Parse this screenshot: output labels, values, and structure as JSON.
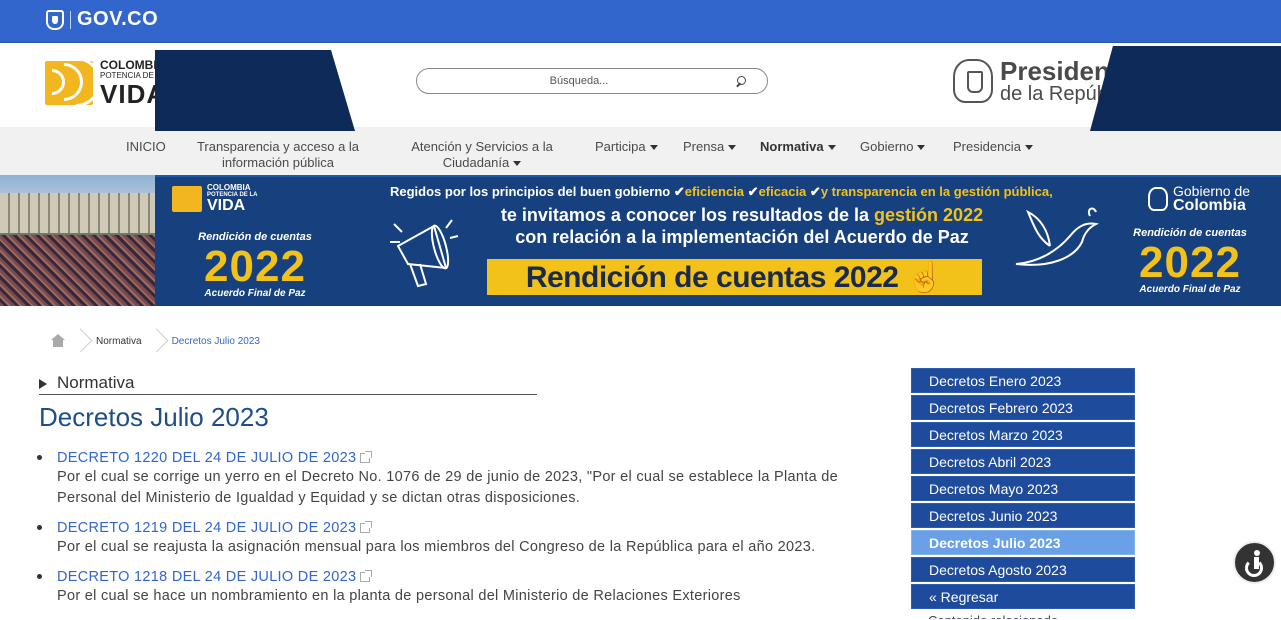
{
  "govco": {
    "logo_text": "GOV.CO"
  },
  "header": {
    "brand": {
      "line1": "COLOMBIA",
      "line2": "POTENCIA DE LA",
      "line3": "VIDA"
    },
    "search_placeholder": "Búsqueda...",
    "presidencia": {
      "line1": "Presidencia",
      "line2": "de la República"
    }
  },
  "nav": {
    "items": [
      {
        "label": "INICIO",
        "dropdown": false
      },
      {
        "label": "Transparencia y acceso a la información pública",
        "dropdown": false
      },
      {
        "label": "Atención y Servicios a la Ciudadanía",
        "dropdown": true
      },
      {
        "label": "Participa",
        "dropdown": true
      },
      {
        "label": "Prensa",
        "dropdown": true
      },
      {
        "label": "Normativa",
        "dropdown": true,
        "active": true
      },
      {
        "label": "Gobierno",
        "dropdown": true
      },
      {
        "label": "Presidencia",
        "dropdown": true
      }
    ]
  },
  "banner": {
    "brand_line1": "COLOMBIA",
    "brand_line2": "POTENCIA DE LA",
    "brand_line3": "VIDA",
    "rendicion_label": "Rendición de cuentas",
    "year": "2022",
    "acuerdo": "Acuerdo Final de Paz",
    "headline_a": "Regidos por los principios del buen gobierno",
    "headline_b": "eficiencia",
    "headline_c": "eficacia",
    "headline_d": "y transparencia en la gestión pública,",
    "sub_a": "te invitamos a conocer los resultados de la",
    "sub_b": "gestión 2022",
    "sub_c": "con relación a la implementación del Acuerdo de Paz",
    "cta": "Rendición de cuentas 2022",
    "gobierno_line1": "Gobierno de",
    "gobierno_line2": "Colombia",
    "colors": {
      "dark_blue": "#17407f",
      "yellow": "#f2c21a"
    }
  },
  "breadcrumb": {
    "items": [
      "Normativa",
      "Decretos Julio 2023"
    ]
  },
  "section": {
    "label": "Normativa"
  },
  "page_title": "Decretos Julio 2023",
  "decrees": [
    {
      "title": "DECRETO 1220 DEL 24 DE JULIO DE 2023",
      "description": "Por el cual se corrige un yerro en el Decreto No. 1076 de 29 de junio de 2023, \"Por el cual se establece la Planta de Personal del Ministerio de Igualdad y Equidad y se dictan otras disposiciones."
    },
    {
      "title": "DECRETO 1219 DEL 24 DE JULIO DE 2023",
      "description": "Por el cual se reajusta la asignación mensual para los miembros del Congreso de la República para el año 2023."
    },
    {
      "title": "DECRETO 1218 DEL 24 DE JULIO DE 2023",
      "description": "Por el cual se hace un nombramiento en la planta de personal del Ministerio de Relaciones Exteriores"
    }
  ],
  "sidebar": {
    "items": [
      {
        "label": "Decretos Enero 2023",
        "active": false
      },
      {
        "label": "Decretos Febrero 2023",
        "active": false
      },
      {
        "label": "Decretos Marzo 2023",
        "active": false
      },
      {
        "label": "Decretos Abril 2023",
        "active": false
      },
      {
        "label": "Decretos Mayo 2023",
        "active": false
      },
      {
        "label": "Decretos Junio 2023",
        "active": false
      },
      {
        "label": "Decretos Julio 2023",
        "active": true
      },
      {
        "label": "Decretos Agosto 2023",
        "active": false
      },
      {
        "label": "« Regresar",
        "active": false
      }
    ],
    "truncated_item": "Contenido relacionado"
  },
  "colors": {
    "gov_blue": "#3366cc",
    "link_blue": "#3366cc",
    "title_blue": "#1d4e89",
    "side_blue": "#1e4b9c",
    "side_active": "#6aa0e8"
  }
}
